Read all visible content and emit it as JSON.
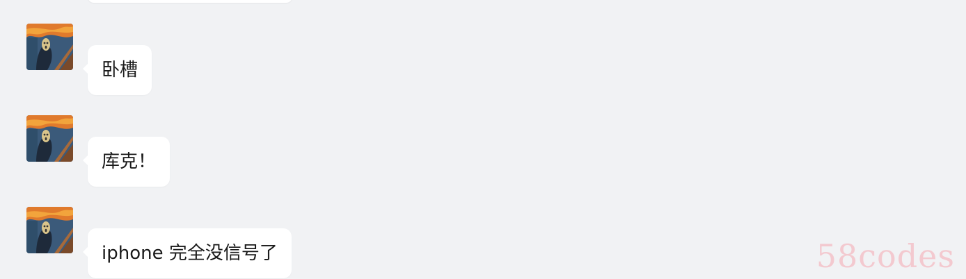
{
  "messages": [
    {
      "text": "卧槽"
    },
    {
      "text": "库克！"
    },
    {
      "text": "iphone 完全没信号了"
    }
  ],
  "watermark": "58codes",
  "colors": {
    "background": "#f1f2f4",
    "bubble": "#ffffff",
    "text": "#1a1a1a",
    "watermark": "#f3c9cf"
  },
  "icons": {
    "avatar": "scream-painting-avatar"
  }
}
